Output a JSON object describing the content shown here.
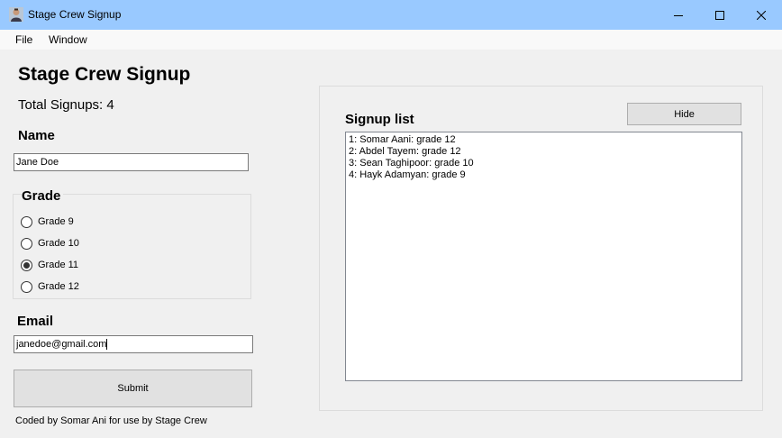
{
  "window": {
    "title": "Stage Crew Signup",
    "icon": "user-avatar-icon",
    "controls": [
      "minimize-icon",
      "maximize-icon",
      "close-icon"
    ]
  },
  "menu": {
    "file": "File",
    "window": "Window"
  },
  "form": {
    "heading": "Stage Crew Signup",
    "total_signups": "Total Signups: 4",
    "name_label": "Name",
    "name_value": "Jane Doe",
    "grade_label": "Grade",
    "grades": [
      {
        "label": "Grade 9",
        "checked": false
      },
      {
        "label": "Grade 10",
        "checked": false
      },
      {
        "label": "Grade 11",
        "checked": true
      },
      {
        "label": "Grade 12",
        "checked": false
      }
    ],
    "email_label": "Email",
    "email_value": "janedoe@gmail.com",
    "submit_label": "Submit",
    "footer": "Coded by Somar Ani for use by Stage Crew"
  },
  "signup_list": {
    "title": "Signup list",
    "hide_label": "Hide",
    "items": [
      "1: Somar Aani: grade 12",
      "2: Abdel Tayem: grade 12",
      "3: Sean Taghipoor: grade 10",
      "4: Hayk Adamyan: grade 9"
    ]
  },
  "colors": {
    "titlebar": "#99c9ff",
    "window_bg": "#f0f0f0",
    "button_bg": "#e1e1e1"
  }
}
